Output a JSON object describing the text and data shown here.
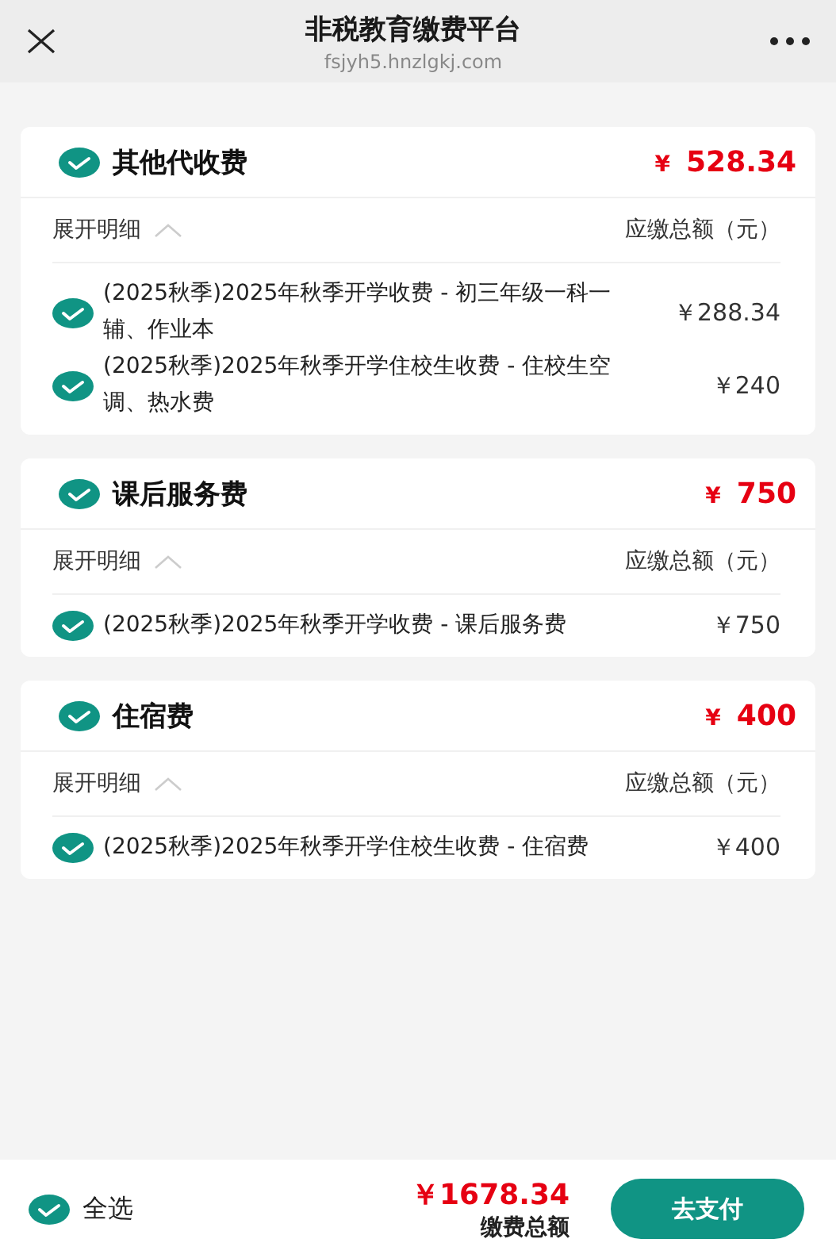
{
  "header": {
    "title": "非税教育缴费平台",
    "url": "fsjyh5.hnzlgkj.com"
  },
  "groups": [
    {
      "name": "其他代收费",
      "checked": true,
      "total": "528.34",
      "currency": "¥",
      "detail_toggle": "展开明细",
      "expanded": true,
      "amount_label": "应缴总额（元）",
      "items": [
        {
          "name": "(2025秋季)2025年秋季开学收费 - 初三年级一科一辅、作业本",
          "checked": true,
          "amount": "￥288.34"
        },
        {
          "name": "(2025秋季)2025年秋季开学住校生收费 - 住校生空调、热水费",
          "checked": true,
          "amount": "￥240"
        }
      ]
    },
    {
      "name": "课后服务费",
      "checked": true,
      "total": "750",
      "currency": "¥",
      "detail_toggle": "展开明细",
      "expanded": true,
      "amount_label": "应缴总额（元）",
      "items": [
        {
          "name": "(2025秋季)2025年秋季开学收费 - 课后服务费",
          "checked": true,
          "amount": "￥750"
        }
      ]
    },
    {
      "name": "住宿费",
      "checked": true,
      "total": "400",
      "currency": "¥",
      "detail_toggle": "展开明细",
      "expanded": true,
      "amount_label": "应缴总额（元）",
      "items": [
        {
          "name": "(2025秋季)2025年秋季开学住校生收费 - 住宿费",
          "checked": true,
          "amount": "￥400"
        }
      ]
    }
  ],
  "footer": {
    "select_all": {
      "label": "全选",
      "checked": true
    },
    "total": "￥1678.34",
    "total_label": "缴费总额",
    "pay_button": "去支付"
  }
}
